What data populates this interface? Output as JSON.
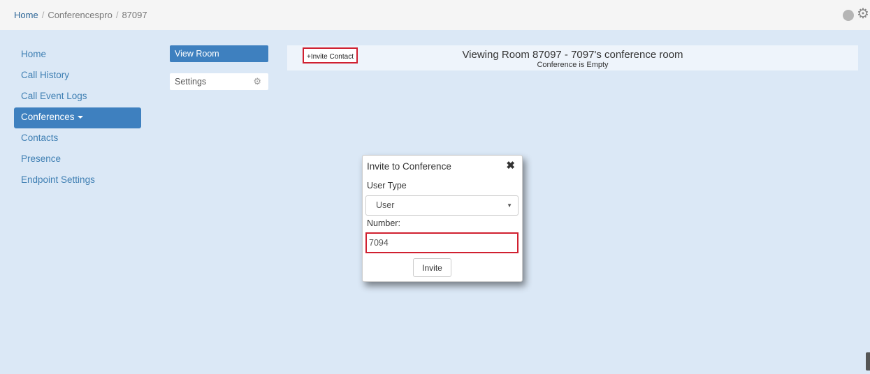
{
  "breadcrumb": {
    "home": "Home",
    "separator": "/",
    "section": "Conferencespro",
    "room": "87097"
  },
  "nav": {
    "items": [
      {
        "label": "Home"
      },
      {
        "label": "Call History"
      },
      {
        "label": "Call Event Logs"
      },
      {
        "label": "Conferences"
      },
      {
        "label": "Contacts"
      },
      {
        "label": "Presence"
      },
      {
        "label": "Endpoint Settings"
      }
    ],
    "active_index": 3
  },
  "subnav": {
    "view_room": "View Room",
    "settings": "Settings"
  },
  "room": {
    "invite_contact": "+Invite Contact",
    "title": "Viewing Room 87097 - 7097's conference room",
    "status": "Conference is Empty"
  },
  "modal": {
    "title": "Invite to Conference",
    "close": "✖",
    "user_type_label": "User Type",
    "user_type_value": "User",
    "number_label": "Number:",
    "number_value": "7094",
    "invite_label": "Invite"
  },
  "icons": {
    "gear": "gear-icon",
    "close": "close-icon",
    "dropdown": "chevron-down-icon"
  },
  "colors": {
    "accent": "#3e80bf",
    "highlight": "#d02030",
    "background": "#dbe8f6"
  }
}
